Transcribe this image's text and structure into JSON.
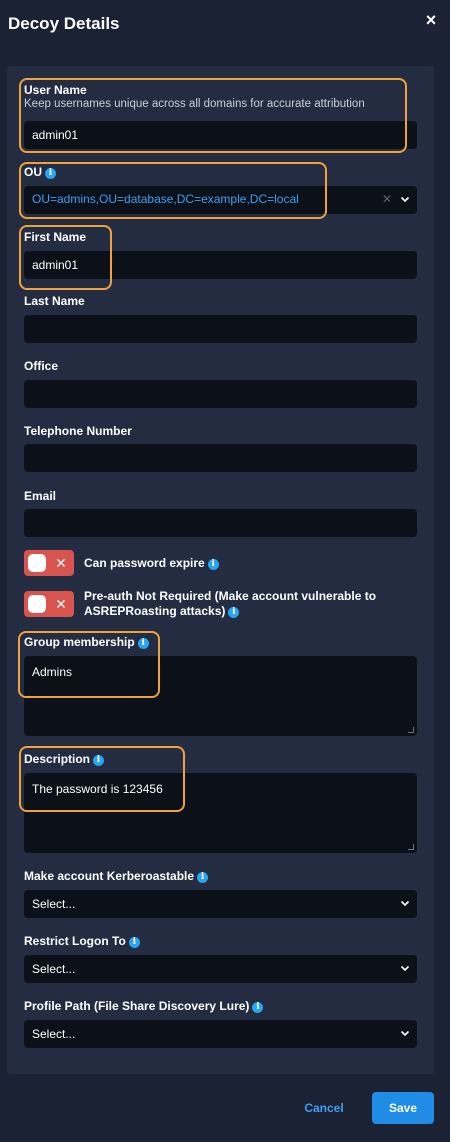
{
  "dialog": {
    "title": "Decoy Details",
    "close_icon": "×"
  },
  "form": {
    "user_name": {
      "label": "User Name",
      "hint": "Keep usernames unique across all domains for accurate attribution",
      "value": "admin01"
    },
    "ou": {
      "label": "OU",
      "value": "OU=admins,OU=database,DC=example,DC=local"
    },
    "first_name": {
      "label": "First Name",
      "value": "admin01"
    },
    "last_name": {
      "label": "Last Name",
      "value": ""
    },
    "office": {
      "label": "Office",
      "value": ""
    },
    "telephone": {
      "label": "Telephone Number",
      "value": ""
    },
    "email": {
      "label": "Email",
      "value": ""
    },
    "password_expire": {
      "label": "Can password expire",
      "enabled": false
    },
    "preauth": {
      "label_line1": "Pre-auth Not Required (Make account vulnerable to",
      "label_line2": "ASREPRoasting attacks)",
      "enabled": false
    },
    "group_membership": {
      "label": "Group membership",
      "value": "Admins"
    },
    "description": {
      "label": "Description",
      "value": "The password is 123456"
    },
    "kerberoastable": {
      "label": "Make account Kerberoastable",
      "value": "Select..."
    },
    "restrict_logon": {
      "label": "Restrict Logon To",
      "value": "Select..."
    },
    "profile_path": {
      "label": "Profile Path (File Share Discovery Lure)",
      "value": "Select..."
    }
  },
  "footer": {
    "cancel_label": "Cancel",
    "save_label": "Save"
  },
  "colors": {
    "background": "#1b2233",
    "panel": "#232c40",
    "input": "#0c1019",
    "accent": "#1f8ce6",
    "link": "#3aa0f5",
    "toggle_off": "#d9534f",
    "highlight": "#f0a23a"
  },
  "icons": {
    "info": "i",
    "chevron": "chevron-down-icon",
    "toggle_x": "✕",
    "clear": "✕"
  }
}
